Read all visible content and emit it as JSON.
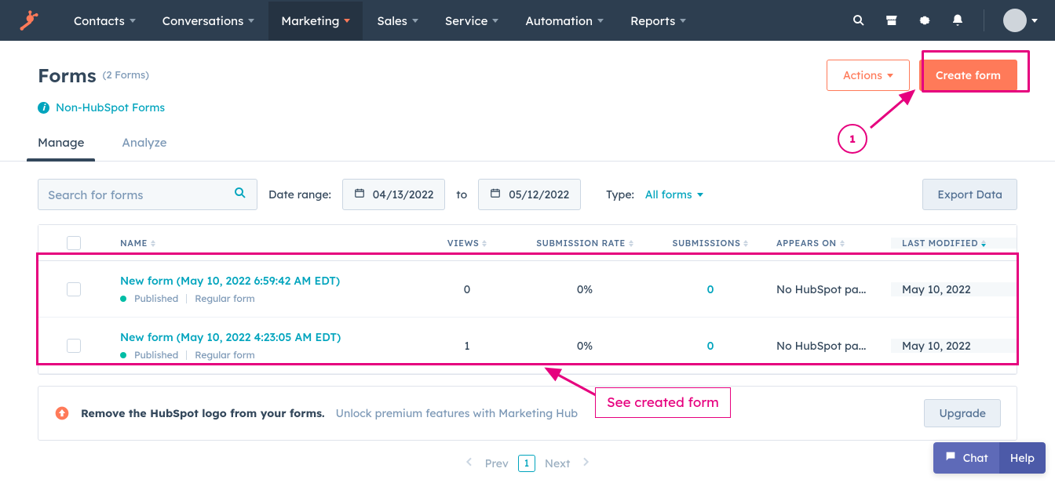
{
  "nav": {
    "items": [
      "Contacts",
      "Conversations",
      "Marketing",
      "Sales",
      "Service",
      "Automation",
      "Reports"
    ],
    "activeIndex": 2
  },
  "page": {
    "title": "Forms",
    "count_text": "(2 Forms)",
    "info_link": "Non-HubSpot Forms",
    "tabs": [
      "Manage",
      "Analyze"
    ],
    "actions_label": "Actions",
    "create_label": "Create form"
  },
  "filters": {
    "search_placeholder": "Search for forms",
    "date_range_label": "Date range:",
    "date_from": "04/13/2022",
    "date_to_label": "to",
    "date_to": "05/12/2022",
    "type_label": "Type:",
    "type_value": "All forms",
    "export_label": "Export Data"
  },
  "table": {
    "headers": {
      "name": "NAME",
      "views": "VIEWS",
      "submission_rate": "SUBMISSION RATE",
      "submissions": "SUBMISSIONS",
      "appears_on": "APPEARS ON",
      "last_modified": "LAST MODIFIED"
    },
    "rows": [
      {
        "name": "New form (May 10, 2022 6:59:42 AM EDT)",
        "status": "Published",
        "type": "Regular form",
        "views": "0",
        "submission_rate": "0%",
        "submissions": "0",
        "appears_on": "No HubSpot pa...",
        "last_modified": "May 10, 2022"
      },
      {
        "name": "New form (May 10, 2022 4:23:05 AM EDT)",
        "status": "Published",
        "type": "Regular form",
        "views": "1",
        "submission_rate": "0%",
        "submissions": "0",
        "appears_on": "No HubSpot pa...",
        "last_modified": "May 10, 2022"
      }
    ]
  },
  "upsell": {
    "title": "Remove the HubSpot logo from your forms.",
    "subtitle": "Unlock premium features with Marketing Hub",
    "button": "Upgrade"
  },
  "pager": {
    "prev": "Prev",
    "page": "1",
    "next": "Next"
  },
  "float": {
    "chat": "Chat",
    "help": "Help"
  },
  "annotations": {
    "circle": "1",
    "label": "See created form"
  }
}
